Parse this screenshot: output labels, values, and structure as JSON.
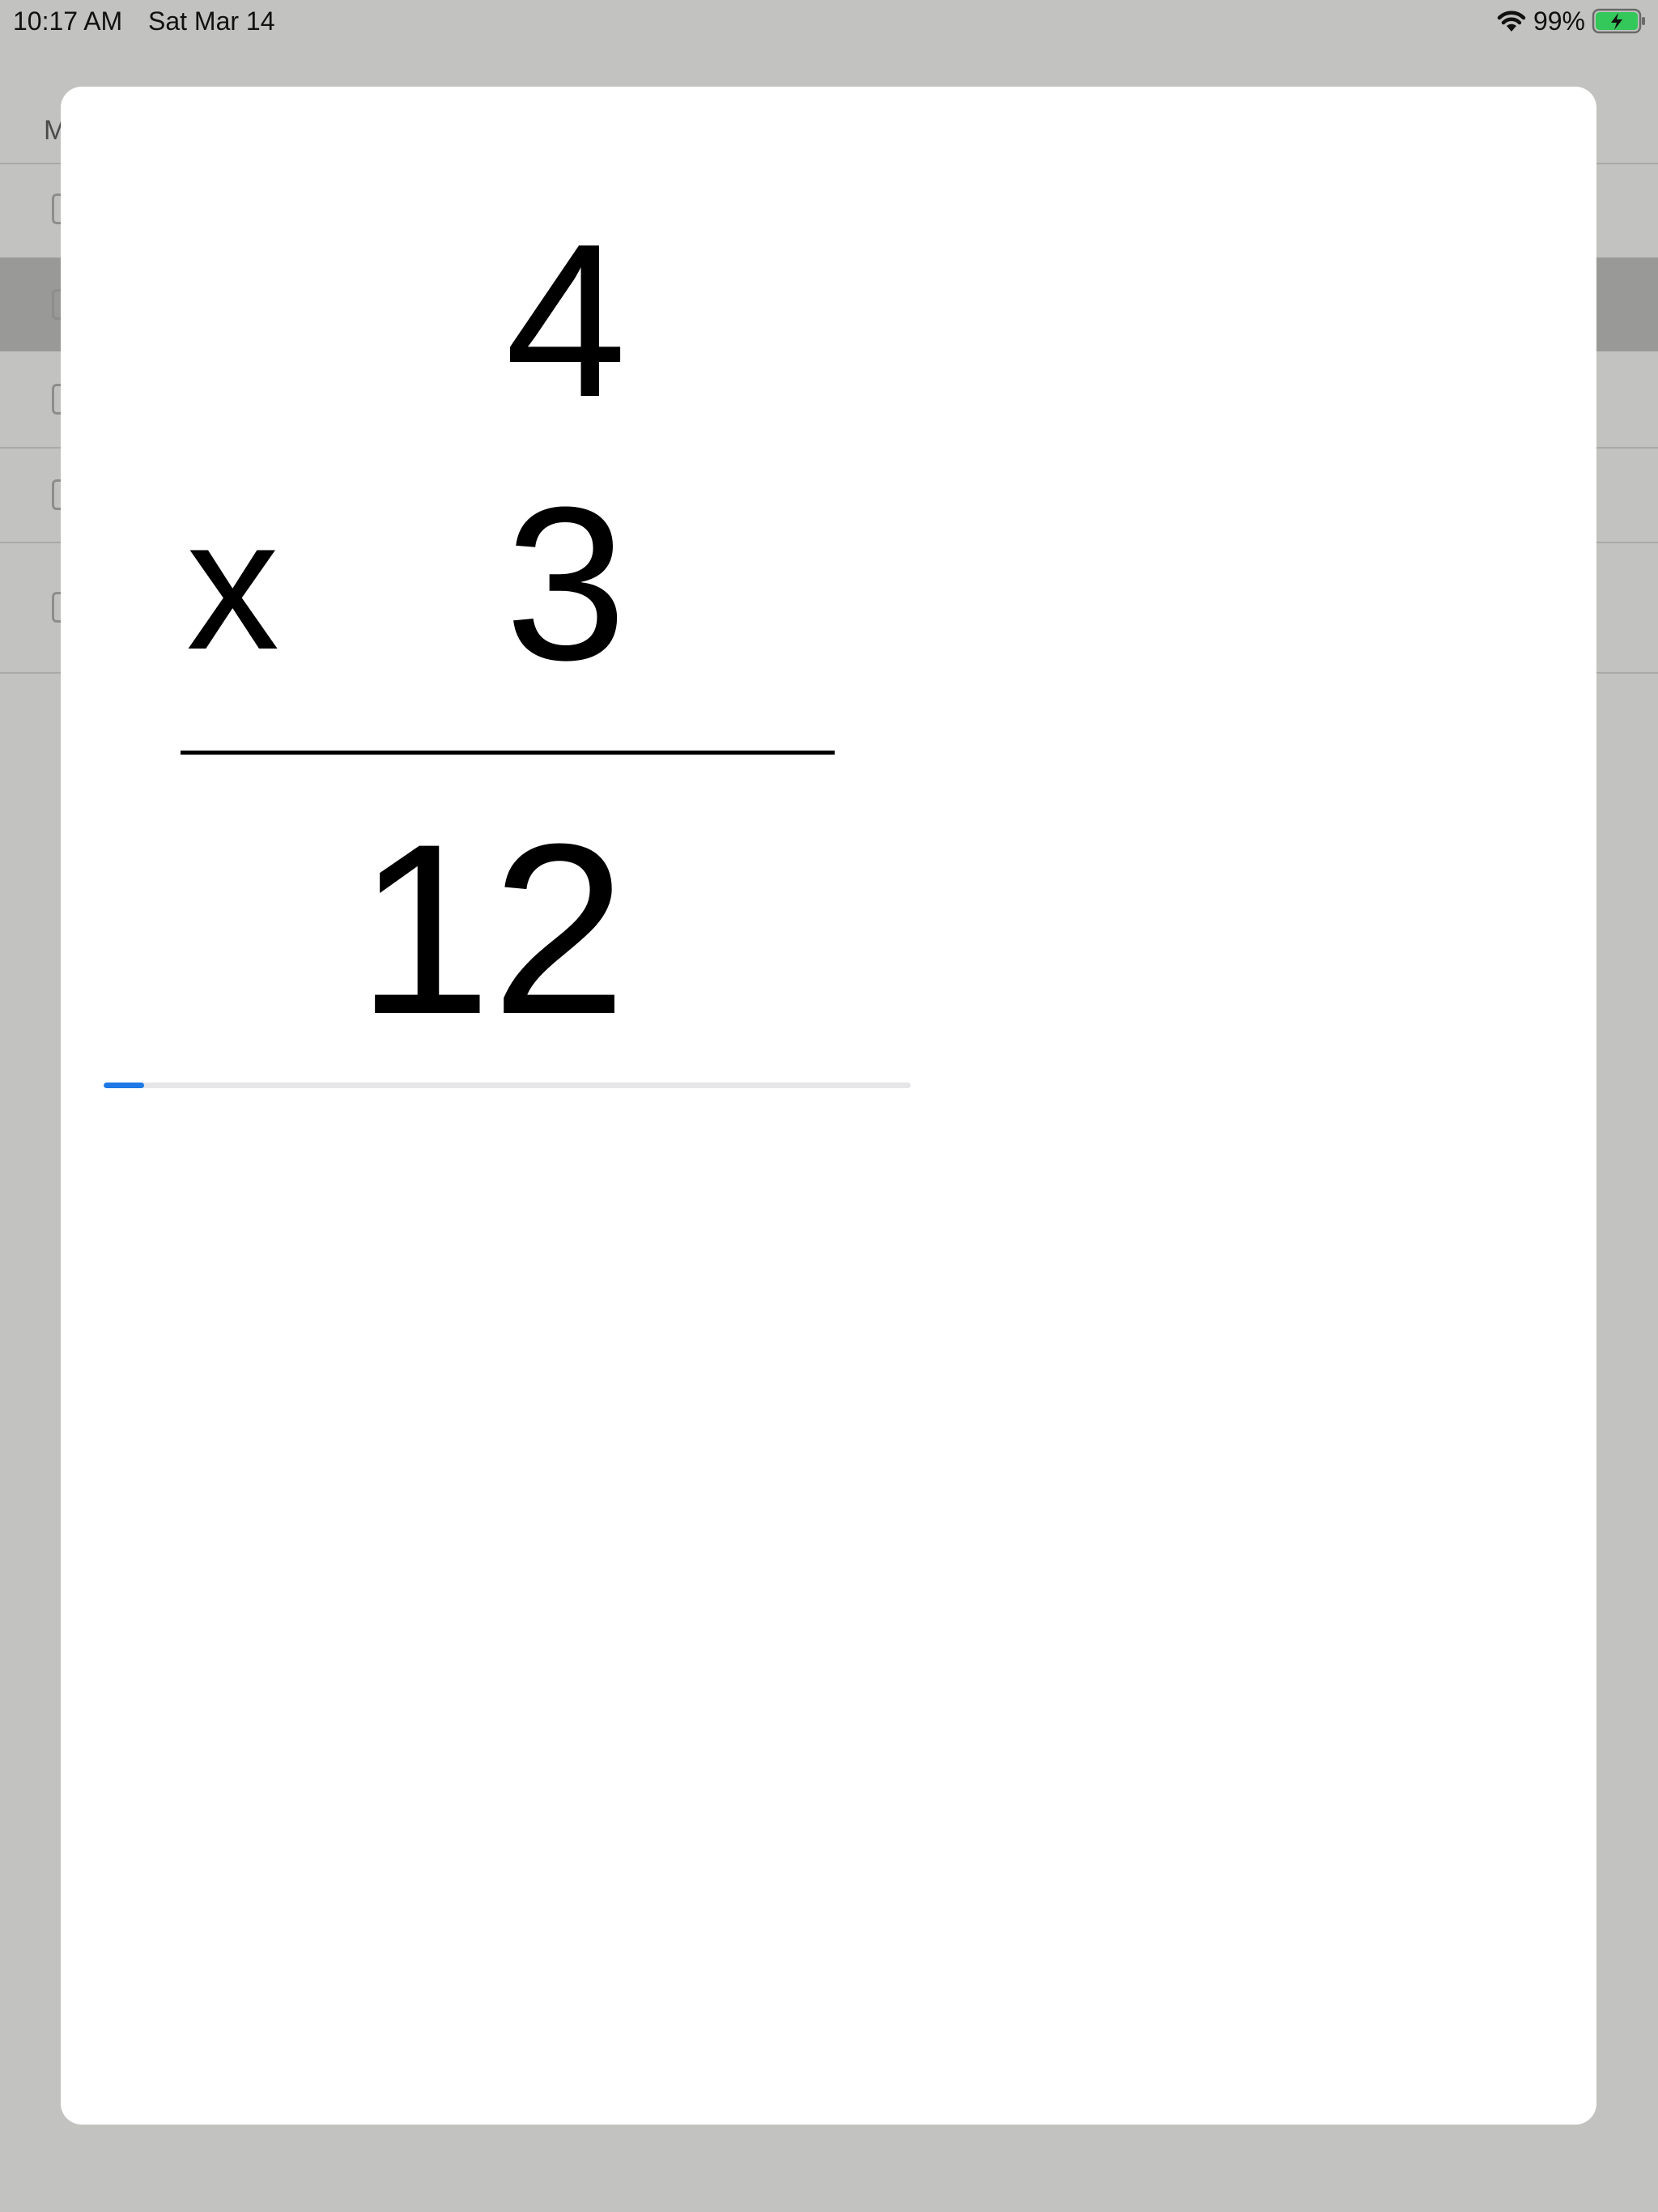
{
  "status_bar": {
    "time": "10:17 AM",
    "date": "Sat Mar 14",
    "battery_percent": "99%",
    "wifi_icon": "wifi-icon",
    "battery_icon": "battery-charging-icon",
    "battery_color": "#34c759"
  },
  "background": {
    "header_letter": "M"
  },
  "problem": {
    "top_number": "4",
    "operator": "x",
    "bottom_number": "3",
    "answer": "12"
  },
  "progress": {
    "fraction": 0.05,
    "color": "#1e78e6"
  }
}
